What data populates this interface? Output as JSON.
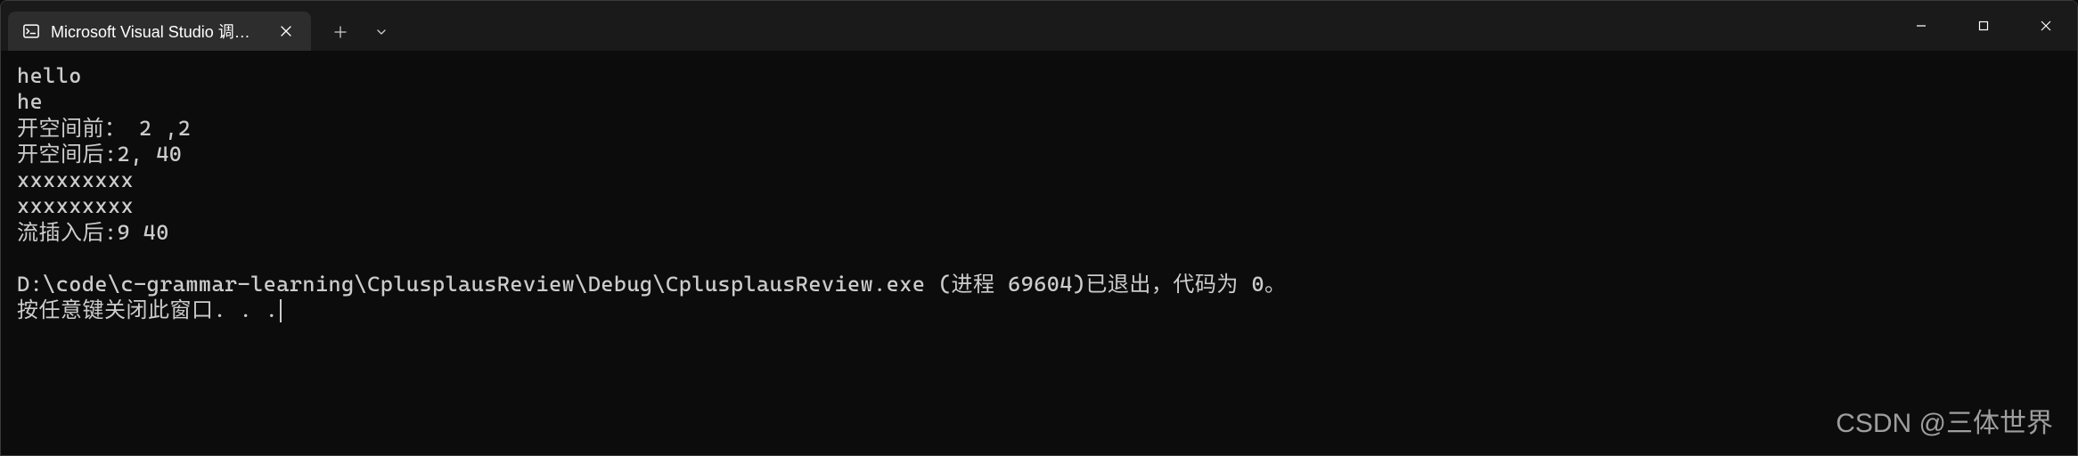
{
  "tab": {
    "title": "Microsoft Visual Studio 调试控"
  },
  "terminal": {
    "lines": [
      "hello",
      "he",
      "开空间前： 2 ,2",
      "开空间后:2, 40",
      "xxxxxxxxx",
      "xxxxxxxxx",
      "流插入后:9 40",
      "",
      "D:\\code\\c-grammar-learning\\CplusplausReview\\Debug\\CplusplausReview.exe (进程 69604)已退出，代码为 0。",
      "按任意键关闭此窗口. . ."
    ]
  },
  "watermark": "CSDN @三体世界"
}
